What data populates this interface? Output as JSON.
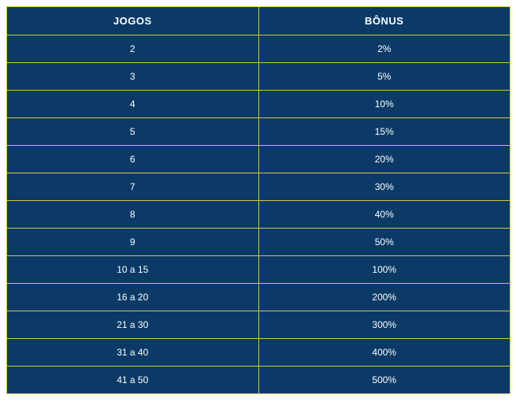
{
  "table": {
    "headers": {
      "jogos": "JOGOS",
      "bonus": "BÔNUS"
    },
    "rows": [
      {
        "jogos": "2",
        "bonus": "2%"
      },
      {
        "jogos": "3",
        "bonus": "5%"
      },
      {
        "jogos": "4",
        "bonus": "10%"
      },
      {
        "jogos": "5",
        "bonus": "15%"
      },
      {
        "jogos": "6",
        "bonus": "20%"
      },
      {
        "jogos": "7",
        "bonus": "30%"
      },
      {
        "jogos": "8",
        "bonus": "40%"
      },
      {
        "jogos": "9",
        "bonus": "50%"
      },
      {
        "jogos": "10 a 15",
        "bonus": "100%"
      },
      {
        "jogos": "16 a 20",
        "bonus": "200%"
      },
      {
        "jogos": "21 a 30",
        "bonus": "300%"
      },
      {
        "jogos": "31 a 40",
        "bonus": "400%"
      },
      {
        "jogos": "41 a 50",
        "bonus": "500%"
      }
    ]
  }
}
